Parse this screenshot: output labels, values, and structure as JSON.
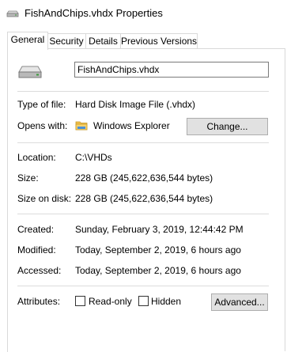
{
  "window": {
    "title": "FishAndChips.vhdx Properties"
  },
  "tabs": [
    {
      "label": "General",
      "active": true
    },
    {
      "label": "Security",
      "active": false
    },
    {
      "label": "Details",
      "active": false
    },
    {
      "label": "Previous Versions",
      "active": false
    }
  ],
  "general": {
    "file_icon": "drive-icon",
    "file_name": "FishAndChips.vhdx",
    "type_label": "Type of file:",
    "type_value": "Hard Disk Image File (.vhdx)",
    "opens_label": "Opens with:",
    "opens_value": "Windows Explorer",
    "opens_icon": "folder-icon",
    "change_button": "Change...",
    "location_label": "Location:",
    "location_value": "C:\\VHDs",
    "size_label": "Size:",
    "size_value": "228 GB (245,622,636,544 bytes)",
    "size_on_disk_label": "Size on disk:",
    "size_on_disk_value": "228 GB (245,622,636,544 bytes)",
    "created_label": "Created:",
    "created_value": "Sunday, February 3, 2019, 12:44:42 PM",
    "modified_label": "Modified:",
    "modified_value": "Today, September 2, 2019, 6 hours ago",
    "accessed_label": "Accessed:",
    "accessed_value": "Today, September 2, 2019, 6 hours ago",
    "attributes_label": "Attributes:",
    "readonly_label": "Read-only",
    "readonly_checked": false,
    "hidden_label": "Hidden",
    "hidden_checked": false,
    "advanced_button": "Advanced..."
  }
}
